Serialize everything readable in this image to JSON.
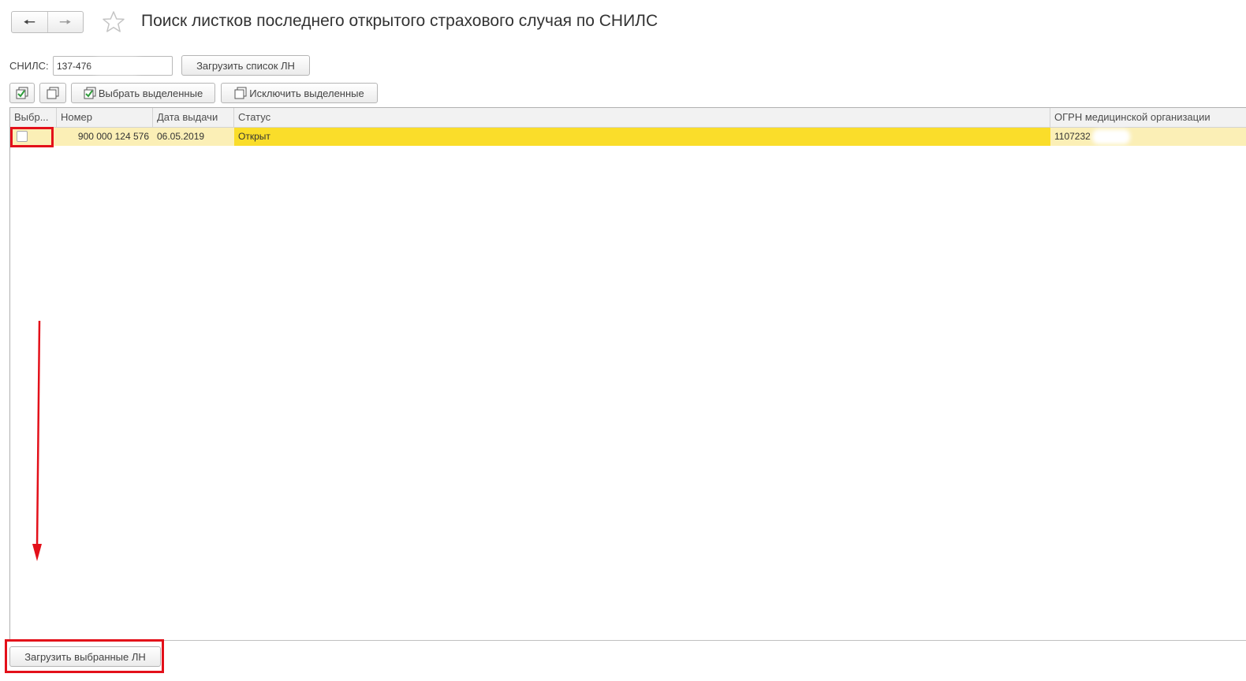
{
  "header": {
    "back_icon": "arrow-left-icon",
    "forward_icon": "arrow-right-icon",
    "favorite_icon": "star-icon",
    "title": "Поиск листков последнего открытого страхового случая по СНИЛС"
  },
  "snils": {
    "label": "СНИЛС:",
    "value": "137-476"
  },
  "buttons": {
    "load_list": "Загрузить список ЛН",
    "select_selected": "Выбрать выделенные",
    "exclude_selected": "Исключить выделенные",
    "load_selected": "Загрузить выбранные ЛН"
  },
  "table": {
    "columns": [
      "Выбр...",
      "Номер",
      "Дата выдачи",
      "Статус",
      "ОГРН медицинской организации"
    ],
    "rows": [
      {
        "selected": false,
        "number": "900 000 124 576",
        "issue_date": "06.05.2019",
        "status": "Открыт",
        "ogrn": "1107232"
      }
    ]
  },
  "colors": {
    "row_highlight": "#fbefb6",
    "status_highlight": "#fadd2a",
    "annotation_red": "#e3101a"
  }
}
